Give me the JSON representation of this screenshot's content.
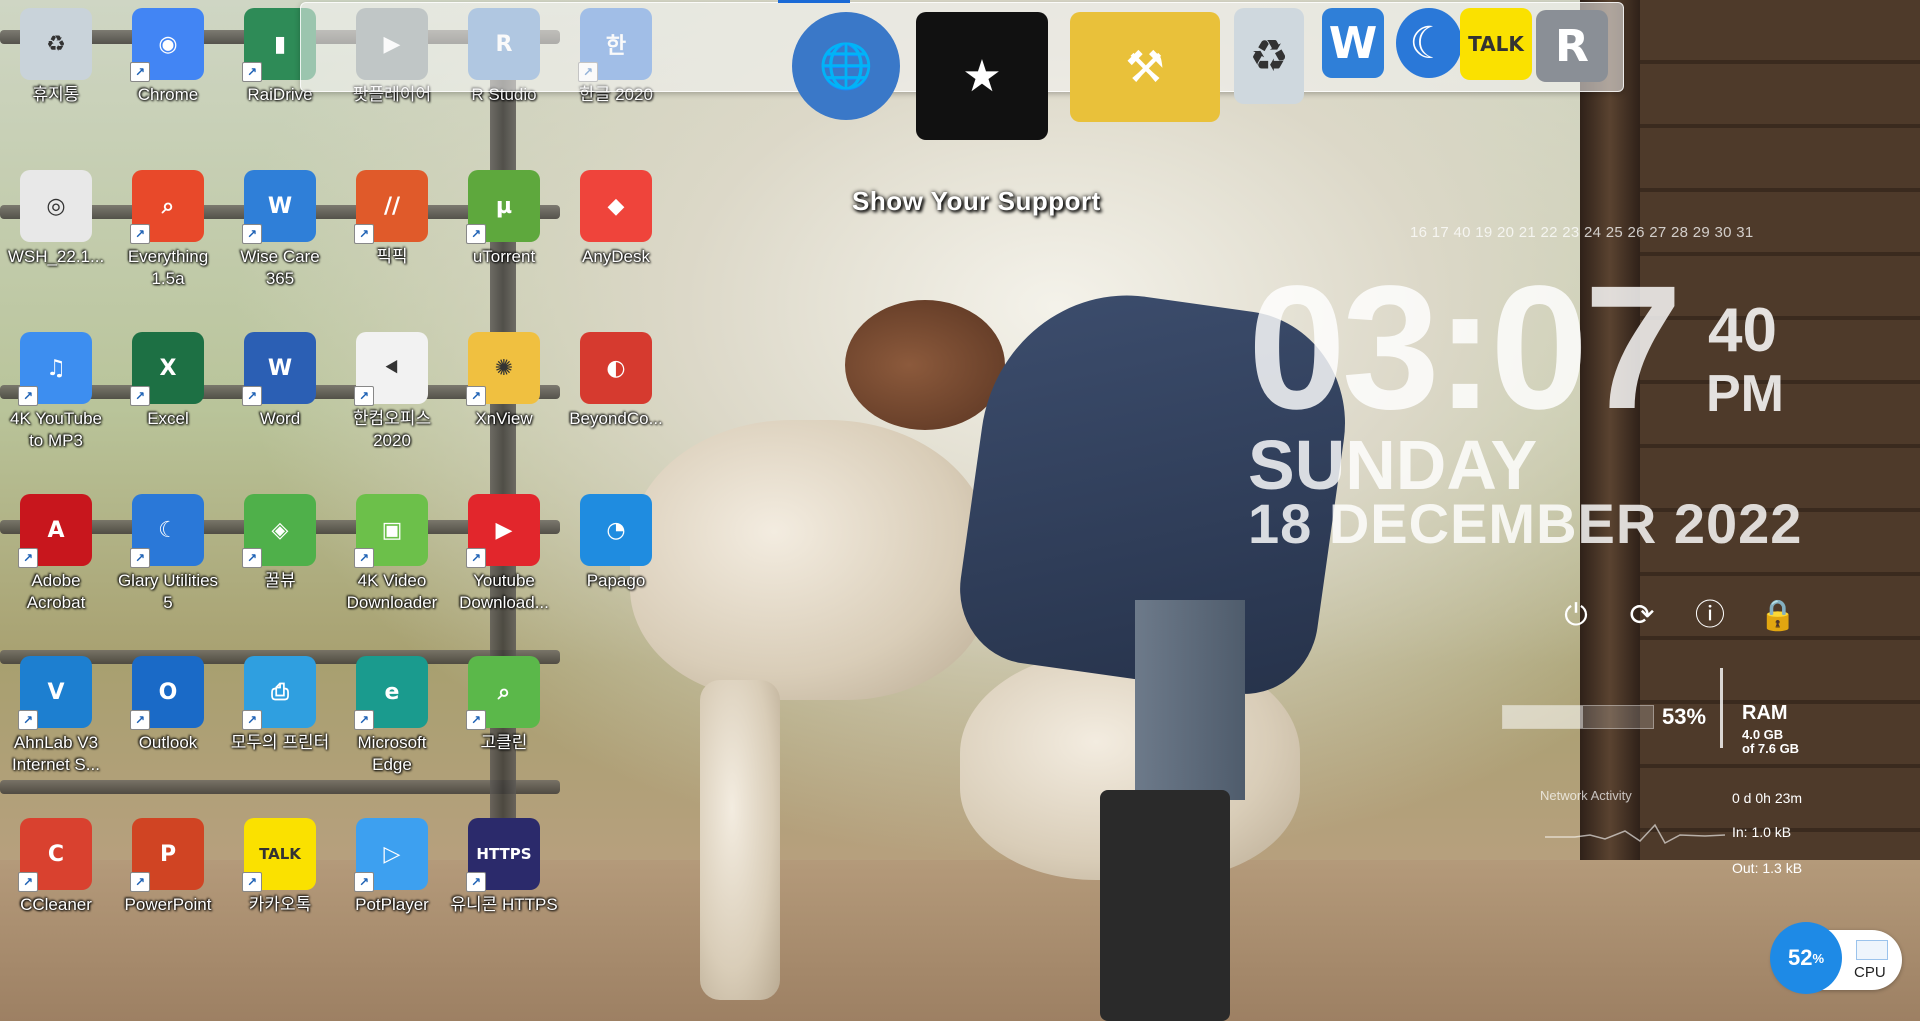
{
  "desktop_icons": [
    {
      "label": "휴지통",
      "icon": "recycle-bin-icon",
      "color": "#c9d3da",
      "glyph": "♻",
      "shortcut": false
    },
    {
      "label": "Chrome",
      "icon": "chrome-icon",
      "color": "#4285f4",
      "glyph": "◉",
      "shortcut": true
    },
    {
      "label": "RaiDrive",
      "icon": "raidrive-icon",
      "color": "#2e8b57",
      "glyph": "▮",
      "shortcut": true
    },
    {
      "label": "팟플레이어",
      "icon": "potplayer-folder-icon",
      "color": "#7f8c8d",
      "glyph": "▶",
      "shortcut": false
    },
    {
      "label": "R Studio",
      "icon": "r-studio-icon",
      "color": "#5b8fc7",
      "glyph": "R",
      "shortcut": false
    },
    {
      "label": "한글 2020",
      "icon": "hangul-icon",
      "color": "#3a7bd5",
      "glyph": "한",
      "shortcut": true
    },
    {
      "label": "WSH_22.1...",
      "icon": "disc-image-icon",
      "color": "#e8e8e8",
      "glyph": "◎",
      "shortcut": false
    },
    {
      "label": "Everything 1.5a",
      "icon": "everything-search-icon",
      "color": "#e8492a",
      "glyph": "⌕",
      "shortcut": true
    },
    {
      "label": "Wise Care 365",
      "icon": "wise-care-icon",
      "color": "#2f7fd8",
      "glyph": "W",
      "shortcut": true
    },
    {
      "label": "픽픽",
      "icon": "picpick-icon",
      "color": "#e05a2a",
      "glyph": "//",
      "shortcut": true
    },
    {
      "label": "uTorrent",
      "icon": "utorrent-icon",
      "color": "#5ea83d",
      "glyph": "µ",
      "shortcut": true
    },
    {
      "label": "AnyDesk",
      "icon": "anydesk-icon",
      "color": "#ef443b",
      "glyph": "◆",
      "shortcut": false
    },
    {
      "label": "4K YouTube to MP3",
      "icon": "youtube-mp3-icon",
      "color": "#3d8ef0",
      "glyph": "♫",
      "shortcut": true
    },
    {
      "label": "Excel",
      "icon": "excel-icon",
      "color": "#1d7044",
      "glyph": "X",
      "shortcut": true
    },
    {
      "label": "Word",
      "icon": "word-icon",
      "color": "#2b5fb4",
      "glyph": "W",
      "shortcut": true
    },
    {
      "label": "한컴오피스 2020",
      "icon": "hancom-office-icon",
      "color": "#f2f2f2",
      "glyph": "⯇",
      "shortcut": true
    },
    {
      "label": "XnView",
      "icon": "xnview-icon",
      "color": "#f0c040",
      "glyph": "✺",
      "shortcut": true
    },
    {
      "label": "BeyondCo...",
      "icon": "beyond-compare-icon",
      "color": "#d63a2f",
      "glyph": "◐",
      "shortcut": false
    },
    {
      "label": "Adobe Acrobat",
      "icon": "acrobat-icon",
      "color": "#c8161d",
      "glyph": "A",
      "shortcut": true
    },
    {
      "label": "Glary Utilities 5",
      "icon": "glary-utilities-icon",
      "color": "#2a78d8",
      "glyph": "☾",
      "shortcut": true
    },
    {
      "label": "꿀뷰",
      "icon": "honeyview-icon",
      "color": "#4fb04a",
      "glyph": "◈",
      "shortcut": true
    },
    {
      "label": "4K Video Downloader",
      "icon": "video-downloader-icon",
      "color": "#6cc04a",
      "glyph": "▣",
      "shortcut": true
    },
    {
      "label": "Youtube Download...",
      "icon": "youtube-downloader-icon",
      "color": "#e2262c",
      "glyph": "▶",
      "shortcut": true
    },
    {
      "label": "Papago",
      "icon": "papago-icon",
      "color": "#1f8ce0",
      "glyph": "◔",
      "shortcut": false
    },
    {
      "label": "AhnLab V3 Internet S...",
      "icon": "ahnlab-v3-icon",
      "color": "#1d7fd0",
      "glyph": "V",
      "shortcut": true
    },
    {
      "label": "Outlook",
      "icon": "outlook-icon",
      "color": "#1a6ac7",
      "glyph": "O",
      "shortcut": true
    },
    {
      "label": "모두의 프린터",
      "icon": "printer-icon",
      "color": "#2f9fe0",
      "glyph": "⎙",
      "shortcut": true
    },
    {
      "label": "Microsoft Edge",
      "icon": "edge-icon",
      "color": "#1a9b8e",
      "glyph": "e",
      "shortcut": true
    },
    {
      "label": "고클린",
      "icon": "goclean-icon",
      "color": "#5bb84a",
      "glyph": "⌕",
      "shortcut": true
    },
    {
      "label": "CCleaner",
      "icon": "ccleaner-icon",
      "color": "#d9412f",
      "glyph": "C",
      "shortcut": true
    },
    {
      "label": "PowerPoint",
      "icon": "powerpoint-icon",
      "color": "#d04423",
      "glyph": "P",
      "shortcut": true
    },
    {
      "label": "카카오톡",
      "icon": "kakaotalk-icon",
      "color": "#fae100",
      "glyph": "TALK",
      "shortcut": true
    },
    {
      "label": "PotPlayer",
      "icon": "potplayer-icon",
      "color": "#3da0f0",
      "glyph": "▷",
      "shortcut": true
    },
    {
      "label": "유니콘 HTTPS",
      "icon": "unicorn-https-icon",
      "color": "#2b2a6b",
      "glyph": "HTTPS",
      "shortcut": true
    }
  ],
  "dock": {
    "tooltip": "Show Your Support",
    "items": [
      {
        "icon": "globe-icon",
        "glyph": "🌐"
      },
      {
        "icon": "tshirt-icon",
        "glyph": "★"
      },
      {
        "icon": "hammer-tools-icon",
        "glyph": "⚒"
      },
      {
        "icon": "recycle-bin-icon",
        "glyph": "♻"
      },
      {
        "icon": "wise-care-icon",
        "glyph": "W"
      },
      {
        "icon": "glary-utilities-icon",
        "glyph": "☾"
      },
      {
        "icon": "kakaotalk-icon",
        "glyph": "TALK"
      },
      {
        "icon": "r-studio-icon",
        "glyph": "R"
      }
    ]
  },
  "clock": {
    "calendar_days": "16 17 40 19 20 21 22 23 24 25 26 27 28 29 30 31",
    "time": "03:07",
    "seconds": "40",
    "ampm": "PM",
    "weekday": "SUNDAY",
    "date": "18 DECEMBER  2022"
  },
  "system": {
    "ram_percent": "53%",
    "ram_fraction": 0.53,
    "ram_label": "RAM",
    "ram_used": "4.0 GB",
    "ram_total": "of 7.6 GB",
    "network_title": "Network Activity",
    "uptime": "0 d 0h 23m",
    "net_in": "In: 1.0 kB",
    "net_out": "Out: 1.3 kB",
    "cpu_percent": "52",
    "cpu_unit": "%",
    "cpu_label": "CPU"
  }
}
